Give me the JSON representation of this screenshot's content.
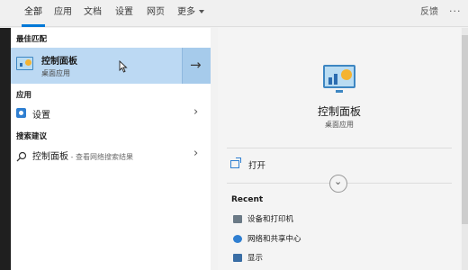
{
  "tabs": [
    {
      "label": "全部",
      "active": true
    },
    {
      "label": "应用"
    },
    {
      "label": "文档"
    },
    {
      "label": "设置"
    },
    {
      "label": "网页"
    },
    {
      "label": "更多"
    }
  ],
  "header": {
    "feedback_label": "反馈",
    "more_options": "···"
  },
  "results": {
    "best_match_section": "最佳匹配",
    "best_match": {
      "title": "控制面板",
      "subtitle": "桌面应用",
      "icon": "control-panel-icon"
    },
    "apps_section": "应用",
    "apps": [
      {
        "label": "设置",
        "icon": "gear-icon"
      }
    ],
    "web_section": "搜索建议",
    "web": [
      {
        "label": "控制面板",
        "hint": " - 查看网络搜索结果",
        "icon": "search-icon"
      }
    ]
  },
  "detail": {
    "title": "控制面板",
    "subtitle": "桌面应用",
    "open_label": "打开",
    "recent_label": "Recent",
    "recent": [
      {
        "label": "设备和打印机",
        "icon": "printer-icon"
      },
      {
        "label": "网络和共享中心",
        "icon": "network-icon"
      },
      {
        "label": "显示",
        "icon": "display-icon"
      }
    ]
  },
  "colors": {
    "accent": "#0078d7",
    "selection": "#bcd9f3"
  }
}
